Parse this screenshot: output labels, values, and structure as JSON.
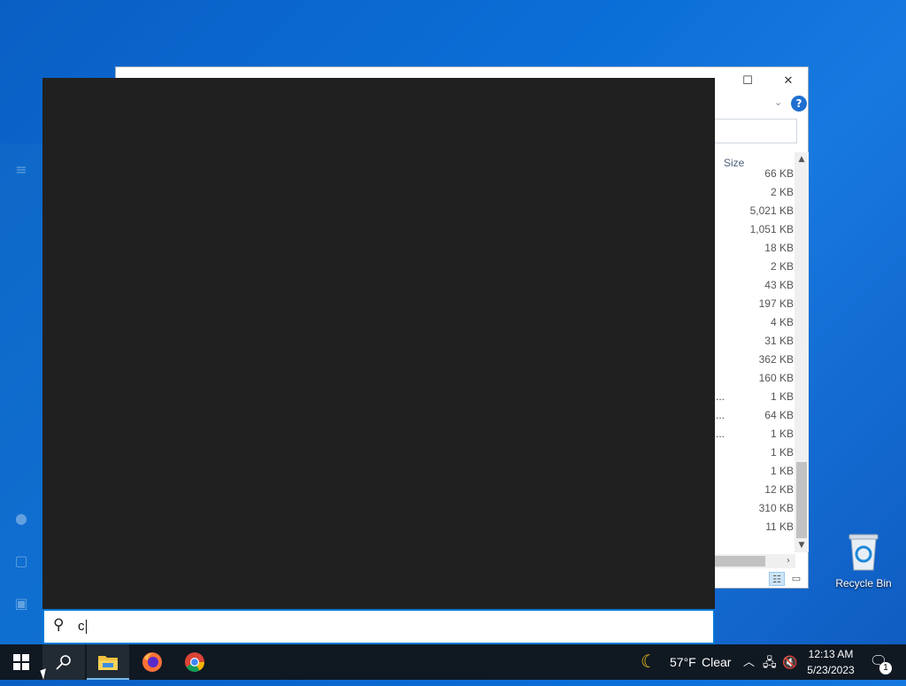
{
  "explorer": {
    "column_header": "Size",
    "sizes": [
      "66 KB",
      "2 KB",
      "5,021 KB",
      "1,051 KB",
      "18 KB",
      "2 KB",
      "43 KB",
      "197 KB",
      "4 KB",
      "31 KB",
      "362 KB",
      "160 KB",
      "1 KB",
      "64 KB",
      "1 KB",
      "1 KB",
      "1 KB",
      "12 KB",
      "310 KB",
      "11 KB"
    ],
    "ellipsis": "...",
    "help_label": "?"
  },
  "search": {
    "query": "c"
  },
  "taskbar": {
    "weather_temp": "57°F",
    "weather_desc": "Clear",
    "time": "12:13 AM",
    "date": "5/23/2023",
    "notification_count": "1"
  },
  "desktop": {
    "recycle_bin_label": "Recycle Bin"
  },
  "colors": {
    "accent": "#0078d7",
    "search_panel_bg": "#202020",
    "taskbar_bg": "#101822"
  }
}
